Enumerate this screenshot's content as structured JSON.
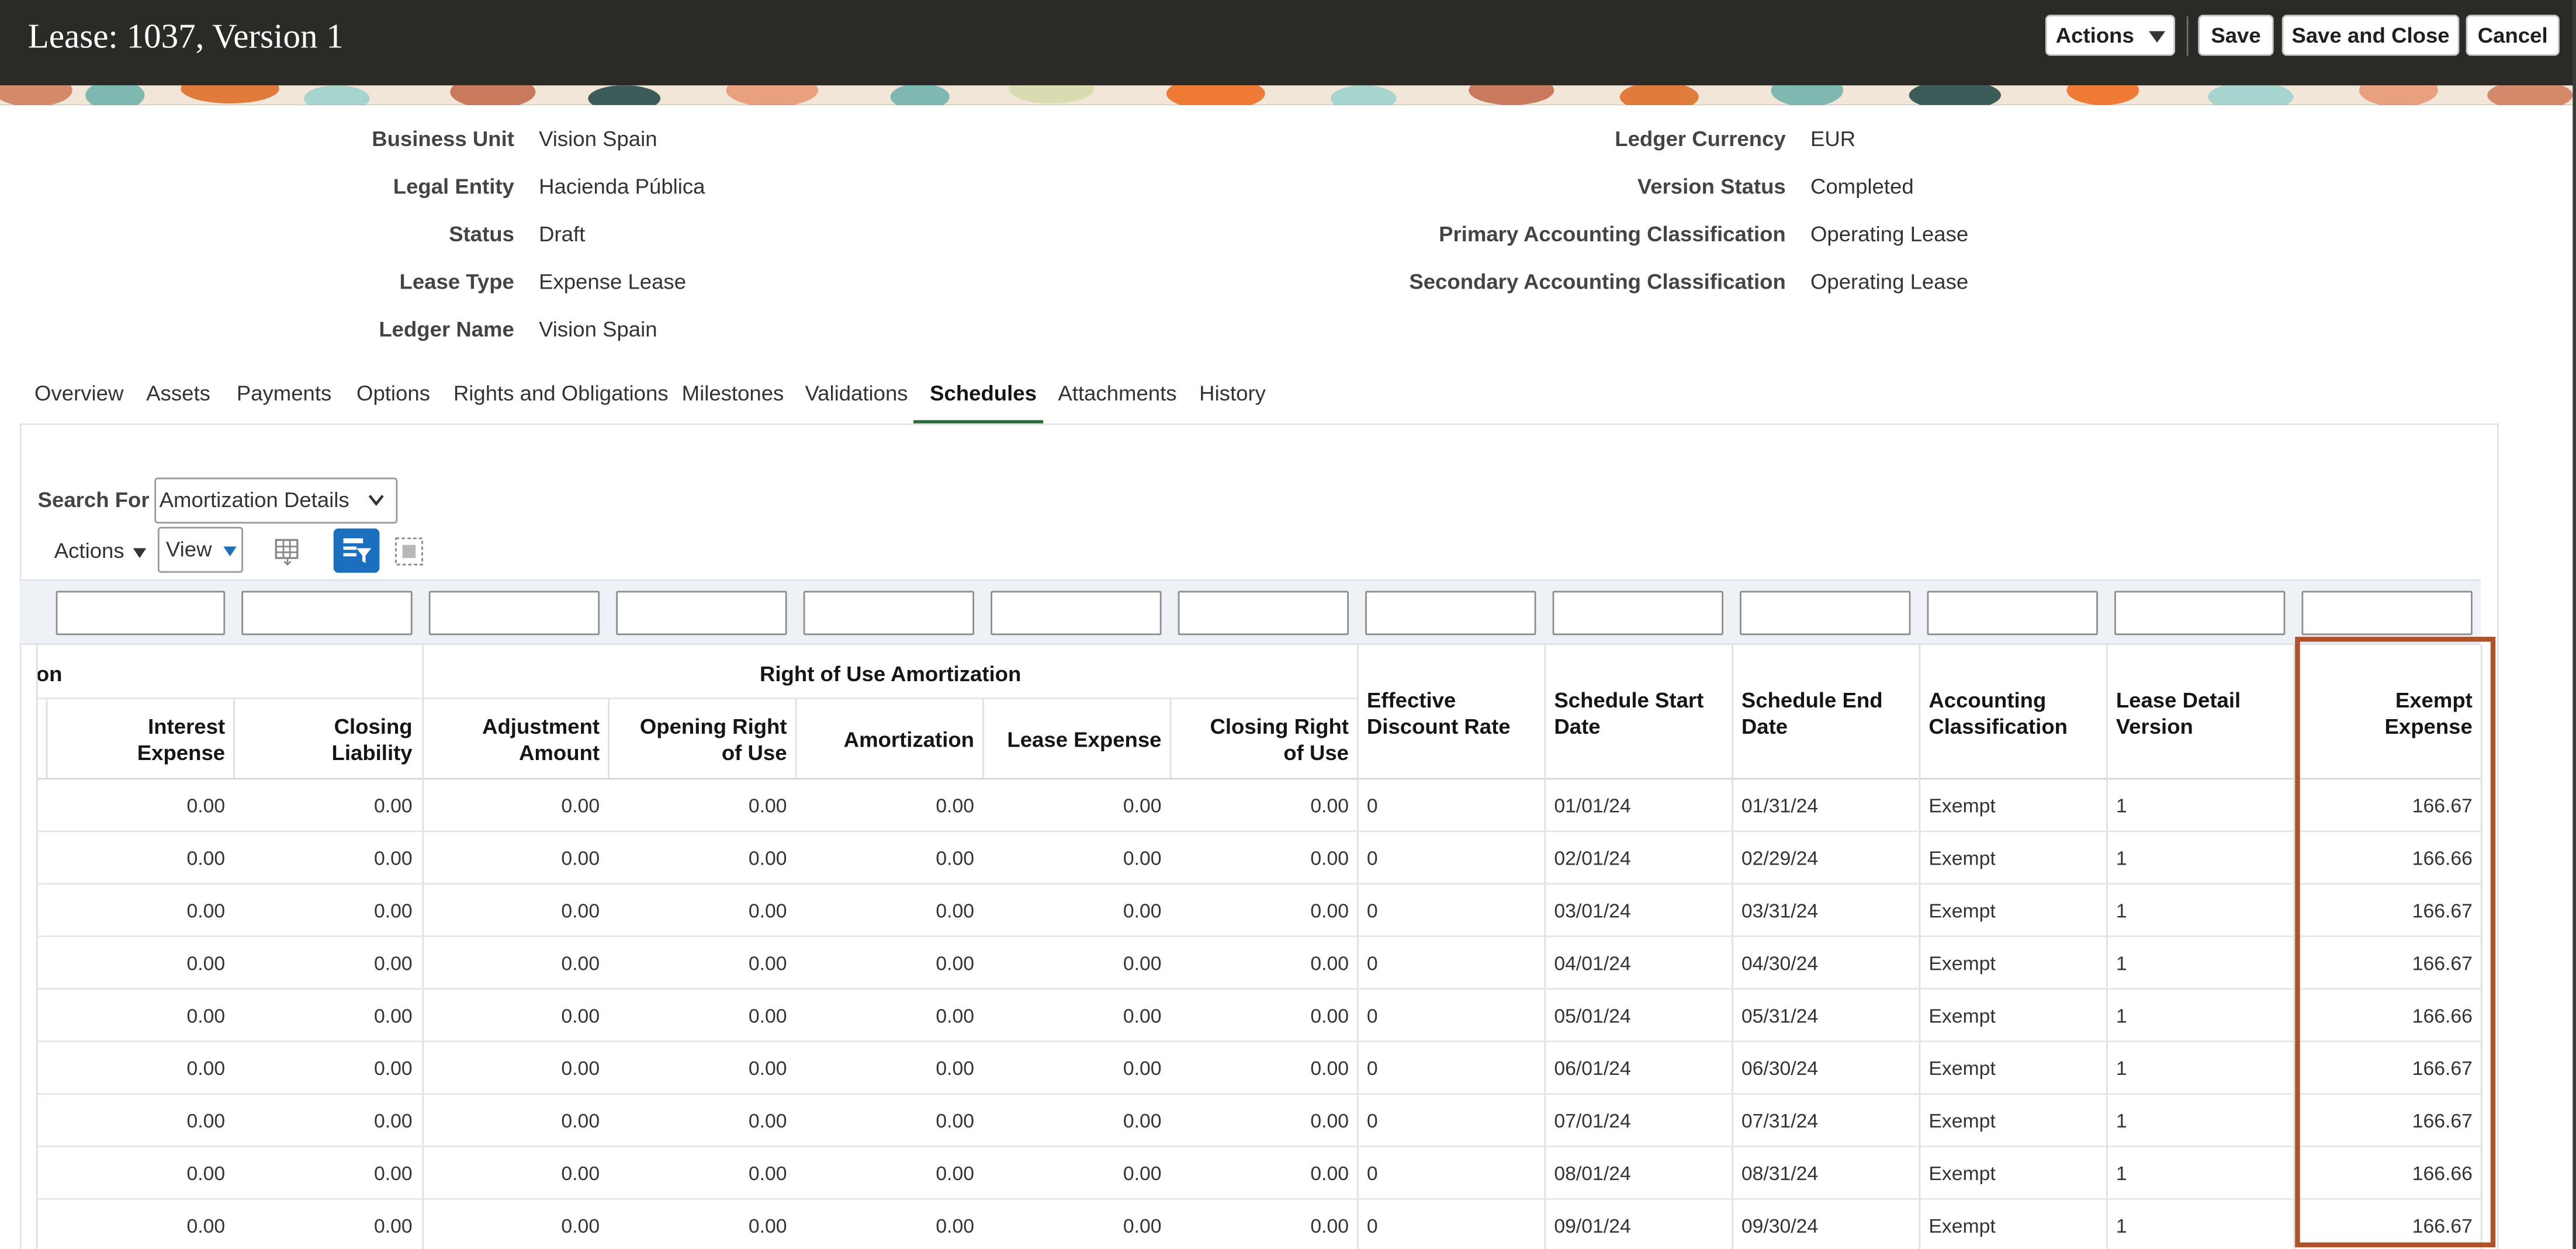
{
  "header": {
    "title": "Lease: 1037, Version 1",
    "actions_label": "Actions",
    "save_label": "Save",
    "save_close_label": "Save and Close",
    "cancel_label": "Cancel"
  },
  "details": {
    "left": [
      {
        "label": "Business Unit",
        "value": "Vision Spain"
      },
      {
        "label": "Legal Entity",
        "value": "Hacienda Pública"
      },
      {
        "label": "Status",
        "value": "Draft"
      },
      {
        "label": "Lease Type",
        "value": "Expense Lease"
      },
      {
        "label": "Ledger Name",
        "value": "Vision Spain"
      }
    ],
    "right": [
      {
        "label": "Ledger Currency",
        "value": "EUR"
      },
      {
        "label": "Version Status",
        "value": "Completed"
      },
      {
        "label": "Primary Accounting Classification",
        "value": "Operating Lease"
      },
      {
        "label": "Secondary Accounting Classification",
        "value": "Operating Lease"
      }
    ]
  },
  "tabs": [
    "Overview",
    "Assets",
    "Payments",
    "Options",
    "Rights and Obligations",
    "Milestones",
    "Validations",
    "Schedules",
    "Attachments",
    "History"
  ],
  "active_tab": "Schedules",
  "search": {
    "label": "Search For",
    "value": "Amortization Details"
  },
  "toolbar": {
    "actions_label": "Actions",
    "view_label": "View"
  },
  "table": {
    "group_headers": [
      "on",
      "Right of Use Amortization"
    ],
    "columns": [
      [
        "Interest",
        "Expense"
      ],
      [
        "Closing",
        "Liability"
      ],
      [
        "Adjustment",
        "Amount"
      ],
      [
        "Opening Right",
        "of Use"
      ],
      [
        "Amortization",
        ""
      ],
      [
        "Lease Expense",
        ""
      ],
      [
        "Closing Right",
        "of Use"
      ],
      [
        "Effective",
        "Discount Rate"
      ],
      [
        "Schedule Start",
        "Date"
      ],
      [
        "Schedule End",
        "Date"
      ],
      [
        "Accounting",
        "Classification"
      ],
      [
        "Lease Detail",
        "Version"
      ],
      [
        "Exempt",
        "Expense"
      ]
    ],
    "rows": [
      [
        "0.00",
        "0.00",
        "0.00",
        "0.00",
        "0.00",
        "0.00",
        "0.00",
        "0",
        "01/01/24",
        "01/31/24",
        "Exempt",
        "1",
        "166.67"
      ],
      [
        "0.00",
        "0.00",
        "0.00",
        "0.00",
        "0.00",
        "0.00",
        "0.00",
        "0",
        "02/01/24",
        "02/29/24",
        "Exempt",
        "1",
        "166.66"
      ],
      [
        "0.00",
        "0.00",
        "0.00",
        "0.00",
        "0.00",
        "0.00",
        "0.00",
        "0",
        "03/01/24",
        "03/31/24",
        "Exempt",
        "1",
        "166.67"
      ],
      [
        "0.00",
        "0.00",
        "0.00",
        "0.00",
        "0.00",
        "0.00",
        "0.00",
        "0",
        "04/01/24",
        "04/30/24",
        "Exempt",
        "1",
        "166.67"
      ],
      [
        "0.00",
        "0.00",
        "0.00",
        "0.00",
        "0.00",
        "0.00",
        "0.00",
        "0",
        "05/01/24",
        "05/31/24",
        "Exempt",
        "1",
        "166.66"
      ],
      [
        "0.00",
        "0.00",
        "0.00",
        "0.00",
        "0.00",
        "0.00",
        "0.00",
        "0",
        "06/01/24",
        "06/30/24",
        "Exempt",
        "1",
        "166.67"
      ],
      [
        "0.00",
        "0.00",
        "0.00",
        "0.00",
        "0.00",
        "0.00",
        "0.00",
        "0",
        "07/01/24",
        "07/31/24",
        "Exempt",
        "1",
        "166.67"
      ],
      [
        "0.00",
        "0.00",
        "0.00",
        "0.00",
        "0.00",
        "0.00",
        "0.00",
        "0",
        "08/01/24",
        "08/31/24",
        "Exempt",
        "1",
        "166.66"
      ],
      [
        "0.00",
        "0.00",
        "0.00",
        "0.00",
        "0.00",
        "0.00",
        "0.00",
        "0",
        "09/01/24",
        "09/30/24",
        "Exempt",
        "1",
        "166.67"
      ]
    ]
  },
  "colors": {
    "header_bg": "#2b2a27",
    "active_tab_underline": "#2a6b3c",
    "highlight_box": "#b0532a",
    "icon_blue": "#1a6fbf"
  }
}
